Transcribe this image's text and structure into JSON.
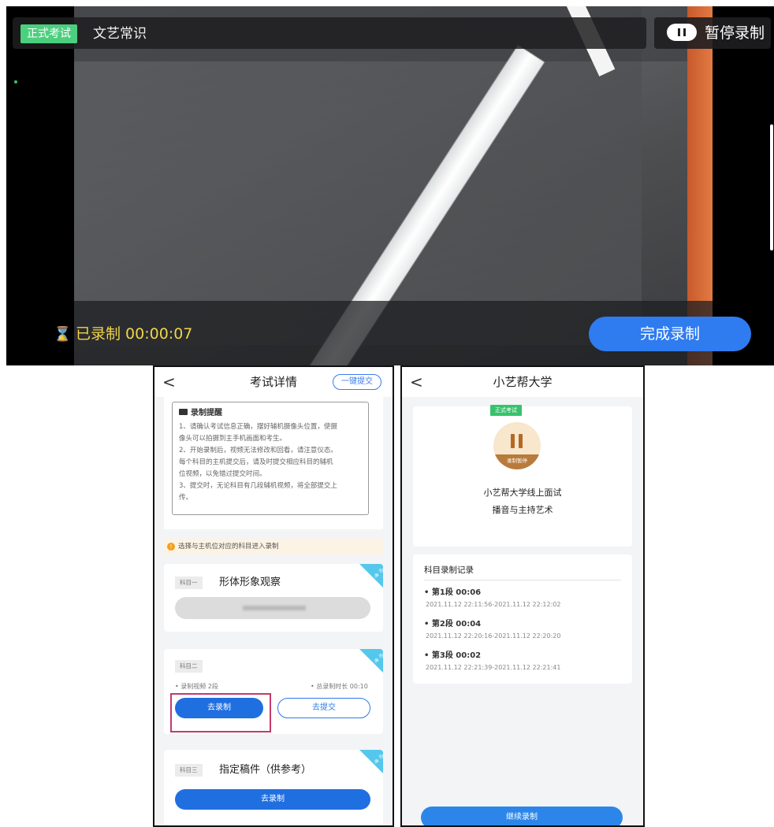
{
  "recorder": {
    "exam_badge": "正式考试",
    "subject_title": "文艺常识",
    "pause_label": "暂停录制",
    "timer_icon": "⌛",
    "timer_text": "已录制 00:00:07",
    "finish_label": "完成录制"
  },
  "exam_detail": {
    "back": "<",
    "title": "考试详情",
    "one_click_submit": "一键提交",
    "reminder_title": "录制提醒",
    "reminder_lines": [
      "1、请确认考试信息正确，摆好辅机摄像头位置，使摄",
      "像头可以拍摄到主手机画面和考生。",
      "2、开始录制后，视频无法修改和回看，请注意仪态。",
      "每个科目的主机提交后，请及时提交相应科目的辅机",
      "位视频，以免错过提交时间。",
      "3、提交时，无论科目有几段辅机视频，将全部提交上",
      "传。"
    ],
    "tip_icon": "!",
    "tip_text": "选择与主机位对应的科目进入录制",
    "corner_label": "必考",
    "subjects": [
      {
        "tag": "科目一",
        "name": "形体形象观察"
      },
      {
        "tag": "科目二",
        "name": "",
        "videos": "• 录制视频 2段",
        "duration": "• 总录制时长 00:10",
        "record_btn": "去录制",
        "submit_btn": "去提交"
      },
      {
        "tag": "科目三",
        "name": "指定稿件（供参考）",
        "record_btn": "去录制"
      }
    ]
  },
  "university": {
    "back": "<",
    "title": "小艺帮大学",
    "exam_tag": "正式考试",
    "pause_state": "录制暂停",
    "exam_name": "小艺帮大学线上面试",
    "major": "播音与主持艺术",
    "record_head": "科目录制记录",
    "segments": [
      {
        "title": "• 第1段 00:06",
        "time": "2021.11.12 22:11:56-2021.11.12 22:12:02"
      },
      {
        "title": "• 第2段 00:04",
        "time": "2021.11.12 22:20:16-2021.11.12 22:20:20"
      },
      {
        "title": "• 第3段 00:02",
        "time": "2021.11.12 22:21:39-2021.11.12 22:21:41"
      }
    ],
    "continue_label": "继续录制"
  }
}
